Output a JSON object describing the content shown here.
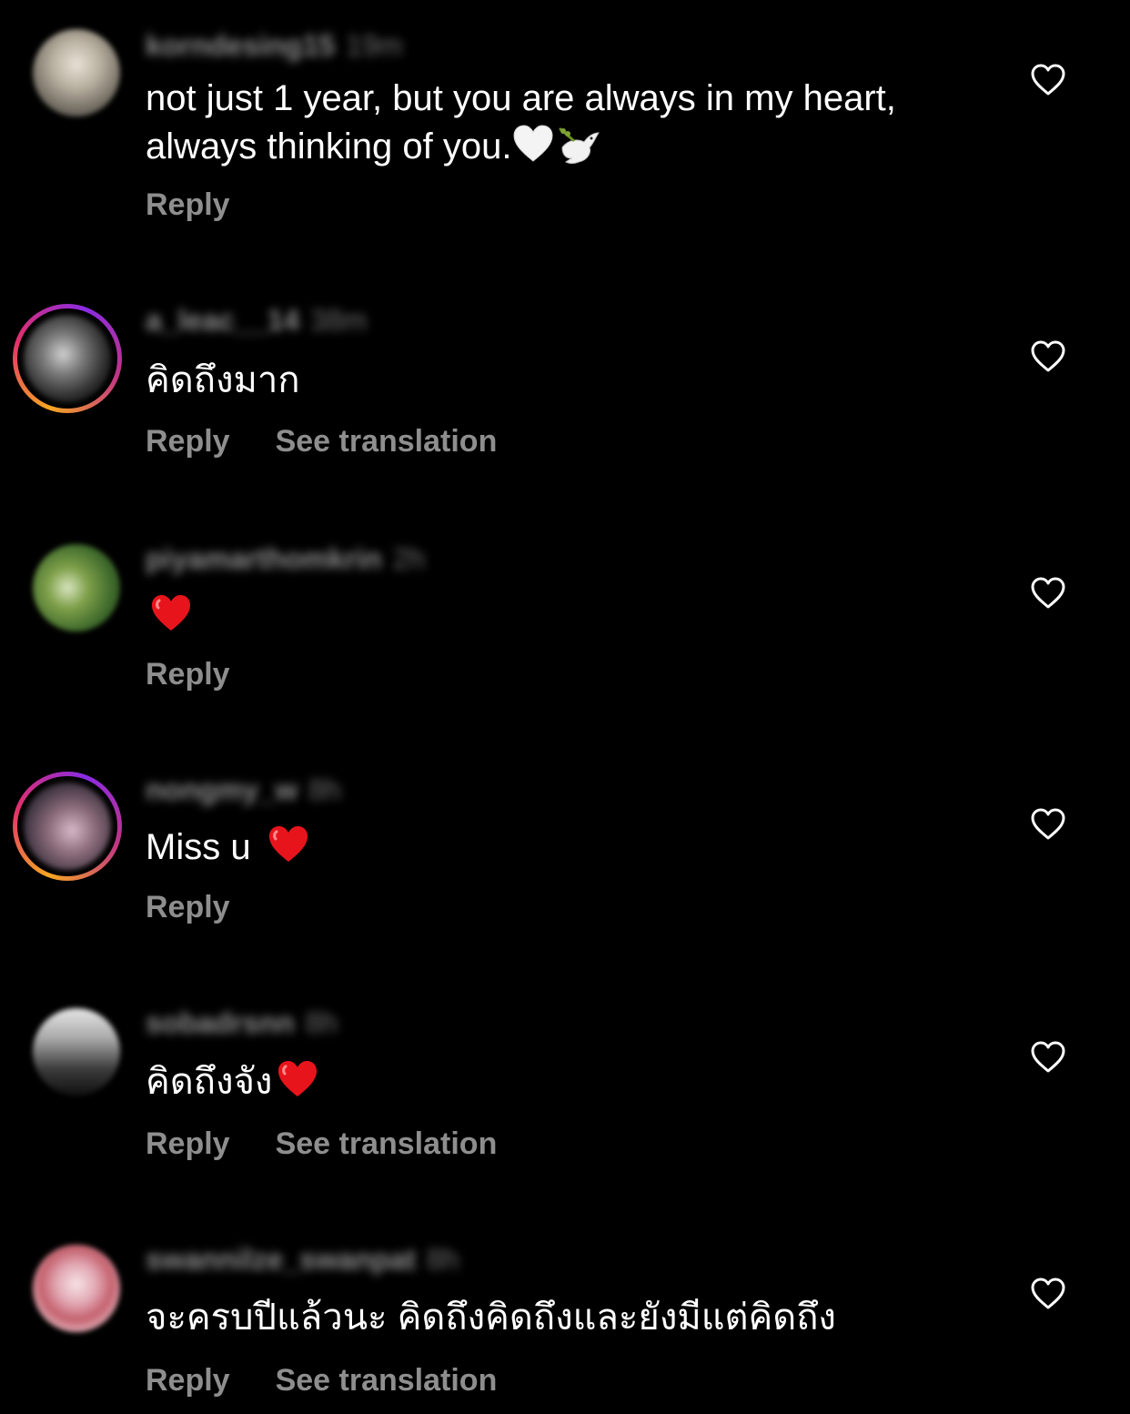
{
  "comments": [
    {
      "username": "korndesing15",
      "time": "19m",
      "text": "not just 1 year, but you  are always in my heart,",
      "text_line2": "always thinking of you.",
      "emojis": [
        "white-heart-emoji",
        "dove-emoji"
      ],
      "reply_label": "Reply",
      "has_story": false
    },
    {
      "username": "a_leac__14",
      "time": "38m",
      "text": "คิดถึงมาก",
      "reply_label": "Reply",
      "translate_label": "See translation",
      "has_story": true
    },
    {
      "username": "piyamarthomkrin",
      "time": "2h",
      "text": "",
      "emojis": [
        "red-heart-emoji"
      ],
      "reply_label": "Reply",
      "has_story": false
    },
    {
      "username": "nongmy_w",
      "time": "8h",
      "text": "Miss u ",
      "emojis": [
        "red-heart-emoji"
      ],
      "reply_label": "Reply",
      "has_story": true
    },
    {
      "username": "sobadrsnn",
      "time": "8h",
      "text": "คิดถึงจัง",
      "emojis": [
        "red-heart-emoji"
      ],
      "reply_label": "Reply",
      "translate_label": "See translation",
      "has_story": false
    },
    {
      "username": "swannilze_swanpat",
      "time": "8h",
      "text": "จะครบปีแล้วนะ คิดถึงคิดถึงและยังมีแต่คิดถึง",
      "reply_label": "Reply",
      "translate_label": "See translation",
      "has_story": false
    }
  ],
  "icons": {
    "like": "heart-outline-icon"
  },
  "colors": {
    "background": "#000000",
    "text": "#ffffff",
    "secondary": "#8e8e8e",
    "heart_red": "#e8141c"
  }
}
